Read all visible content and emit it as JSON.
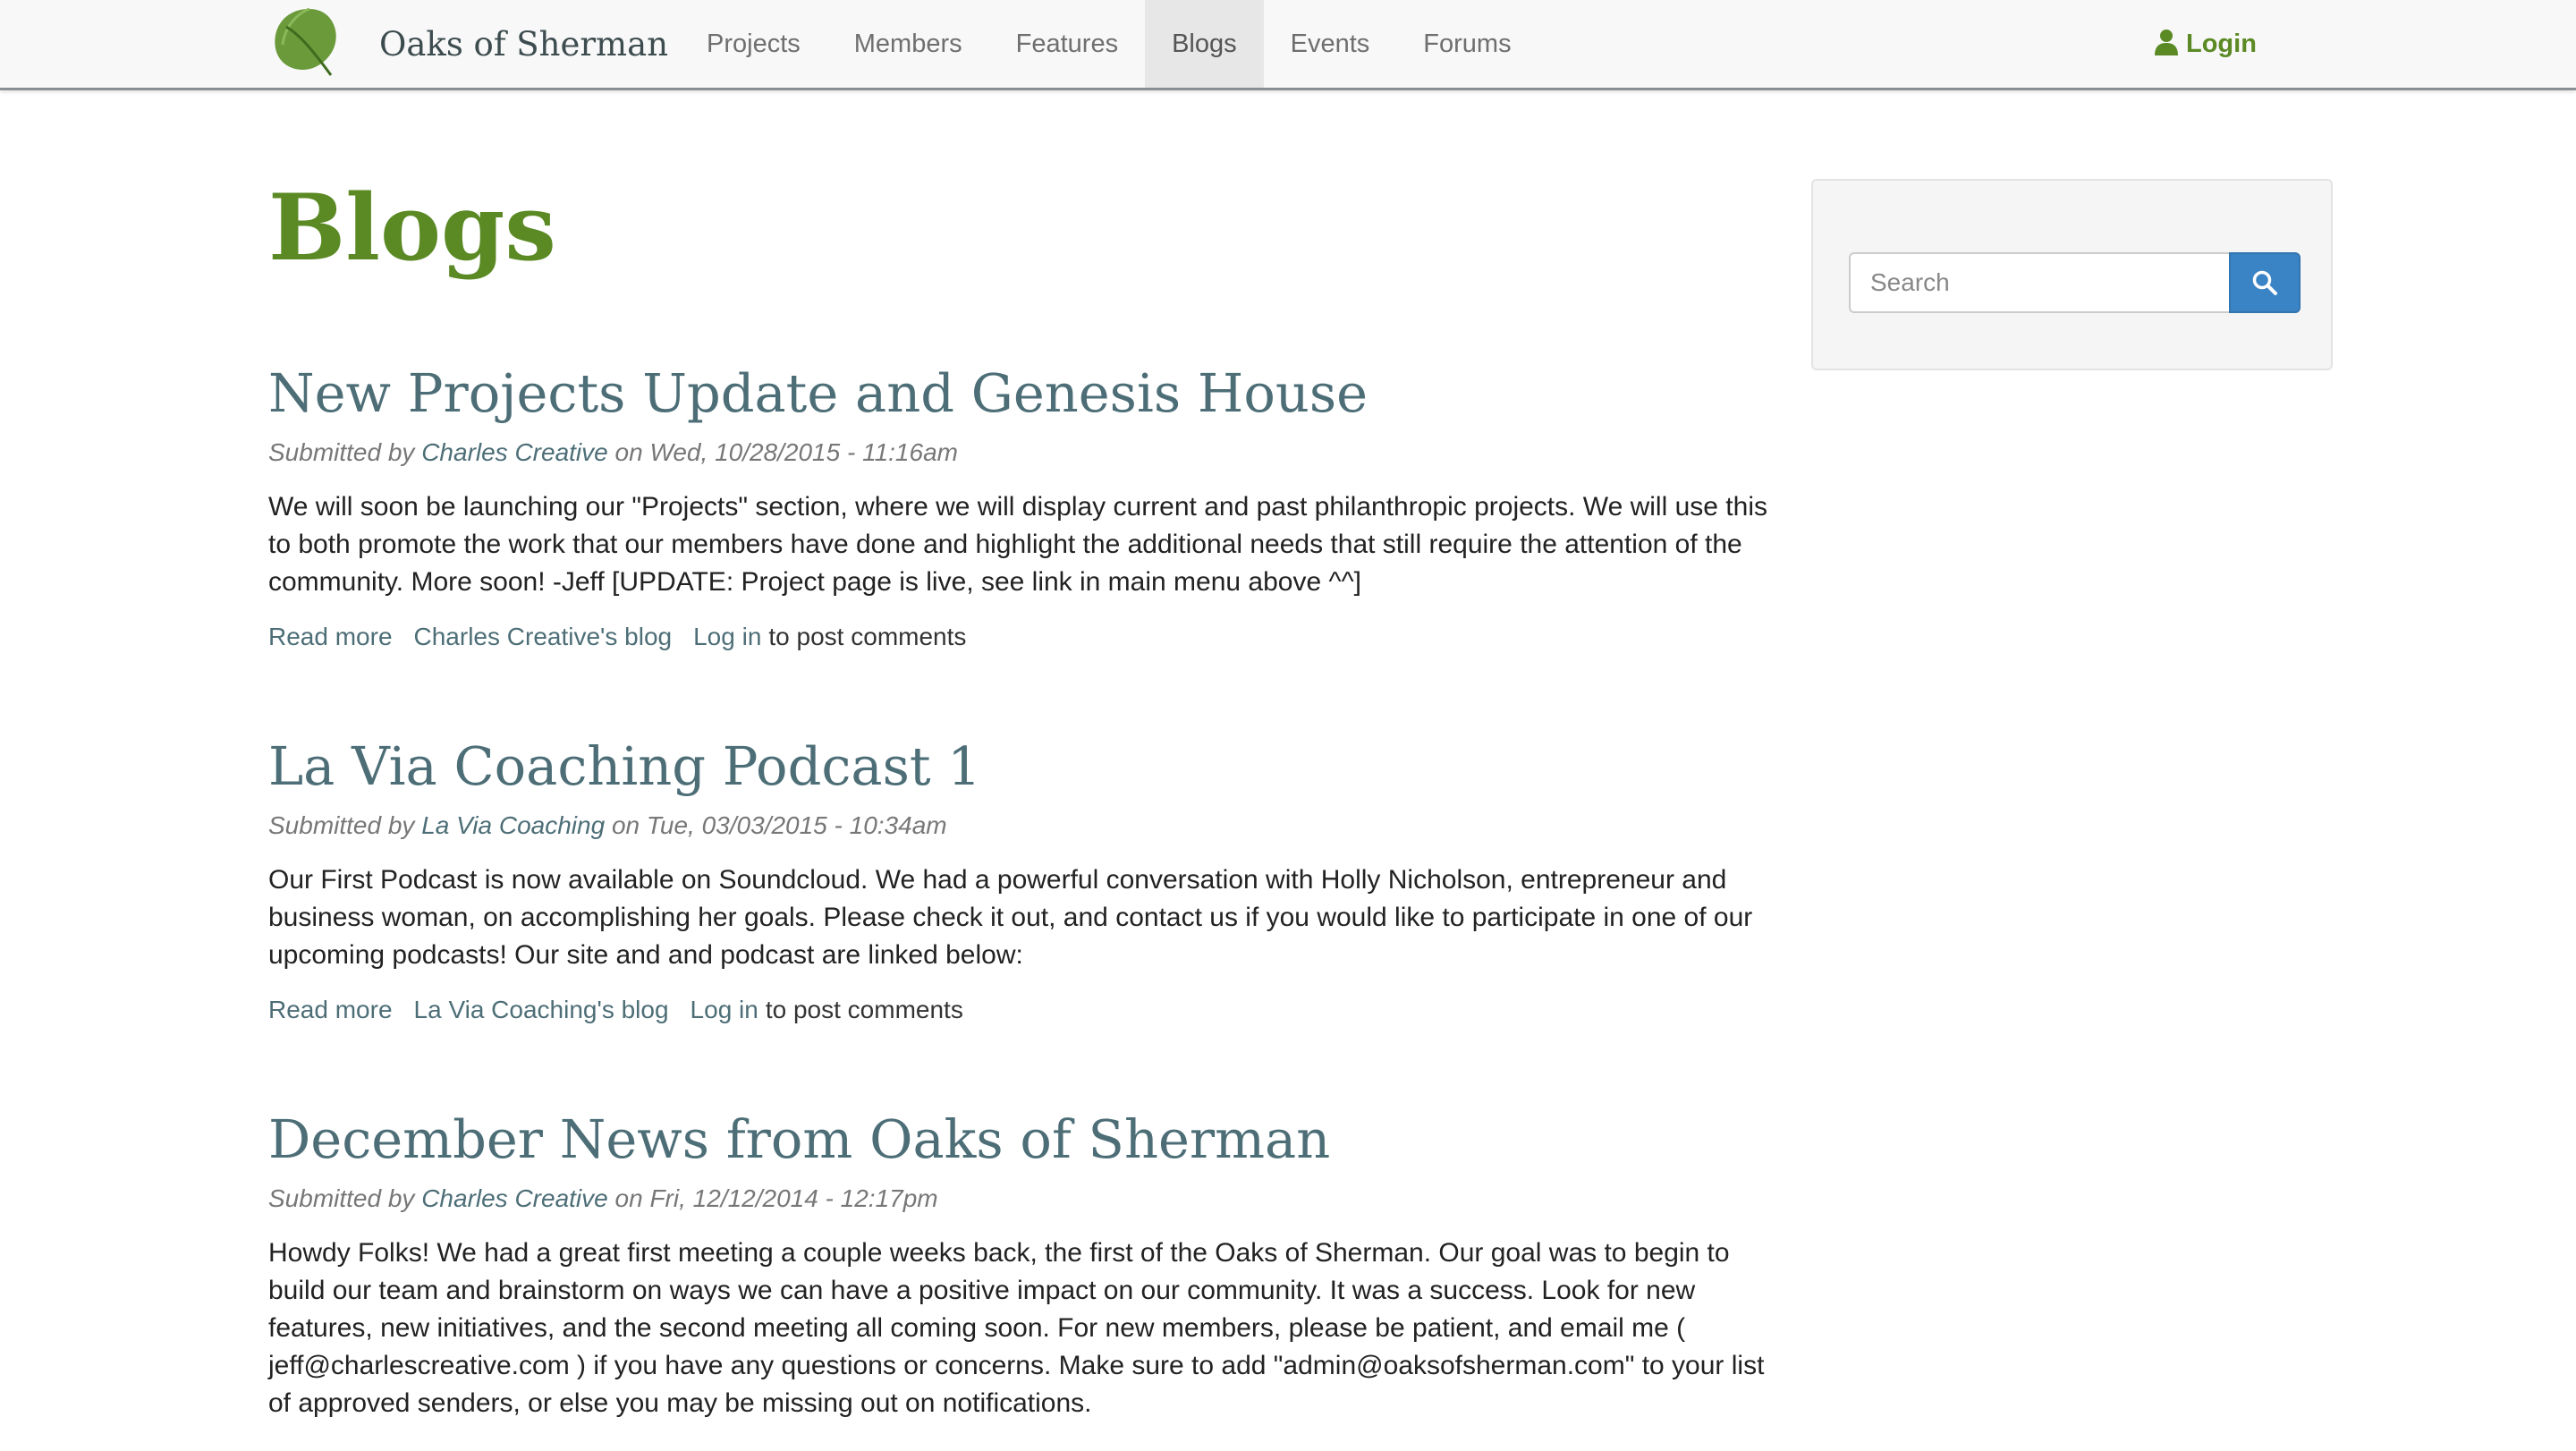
{
  "nav": {
    "brand": "Oaks of Sherman",
    "items": [
      {
        "label": "Projects",
        "active": false
      },
      {
        "label": "Members",
        "active": false
      },
      {
        "label": "Features",
        "active": false
      },
      {
        "label": "Blogs",
        "active": true
      },
      {
        "label": "Events",
        "active": false
      },
      {
        "label": "Forums",
        "active": false
      }
    ],
    "login": "Login",
    "login_icon": "user-icon",
    "logo_icon": "leaf-icon"
  },
  "page": {
    "title": "Blogs"
  },
  "posts": [
    {
      "title": "New Projects Update and Genesis House",
      "submitted_prefix": "Submitted by ",
      "author": "Charles Creative",
      "date_text": " on Wed, 10/28/2015 - 11:16am",
      "body": "We will soon be launching our \"Projects\" section, where we will display current and past philanthropic projects. We will use this to both promote the work that our members have done and highlight the additional needs that still require the attention of the community. More soon! -Jeff [UPDATE: Project page is live, see link in main menu above ^^]",
      "read_more": "Read more",
      "blog_link": "Charles Creative's blog",
      "login_link": "Log in",
      "comments_suffix": "to post comments"
    },
    {
      "title": "La Via Coaching Podcast 1",
      "submitted_prefix": "Submitted by ",
      "author": "La Via Coaching",
      "date_text": " on Tue, 03/03/2015 - 10:34am",
      "body": "Our First Podcast is now available on Soundcloud. We had a powerful conversation with Holly Nicholson, entrepreneur and business woman, on accomplishing her goals. Please check it out, and contact us if you would like to participate in one of our upcoming podcasts! Our site and and podcast are linked below:",
      "read_more": "Read more",
      "blog_link": "La Via Coaching's blog",
      "login_link": "Log in",
      "comments_suffix": "to post comments"
    },
    {
      "title": "December News from Oaks of Sherman",
      "submitted_prefix": "Submitted by ",
      "author": "Charles Creative",
      "date_text": " on Fri, 12/12/2014 - 12:17pm",
      "body": "Howdy Folks! We had a great first meeting a couple weeks back, the first of the Oaks of Sherman. Our goal was to begin to build our team and brainstorm on ways we can have a positive impact on our community. It was a success. Look for new features, new initiatives, and the second meeting all coming soon. For new members, please be patient, and email me ( jeff@charlescreative.com ) if you have any questions or concerns. Make sure to add \"admin@oaksofsherman.com\" to your list of approved senders, or else you may be missing out on notifications."
    }
  ],
  "search": {
    "placeholder": "Search",
    "icon": "search-icon"
  },
  "colors": {
    "brand_green": "#5b8a25",
    "title_teal": "#4d6e77",
    "search_button": "#3a84c5"
  }
}
